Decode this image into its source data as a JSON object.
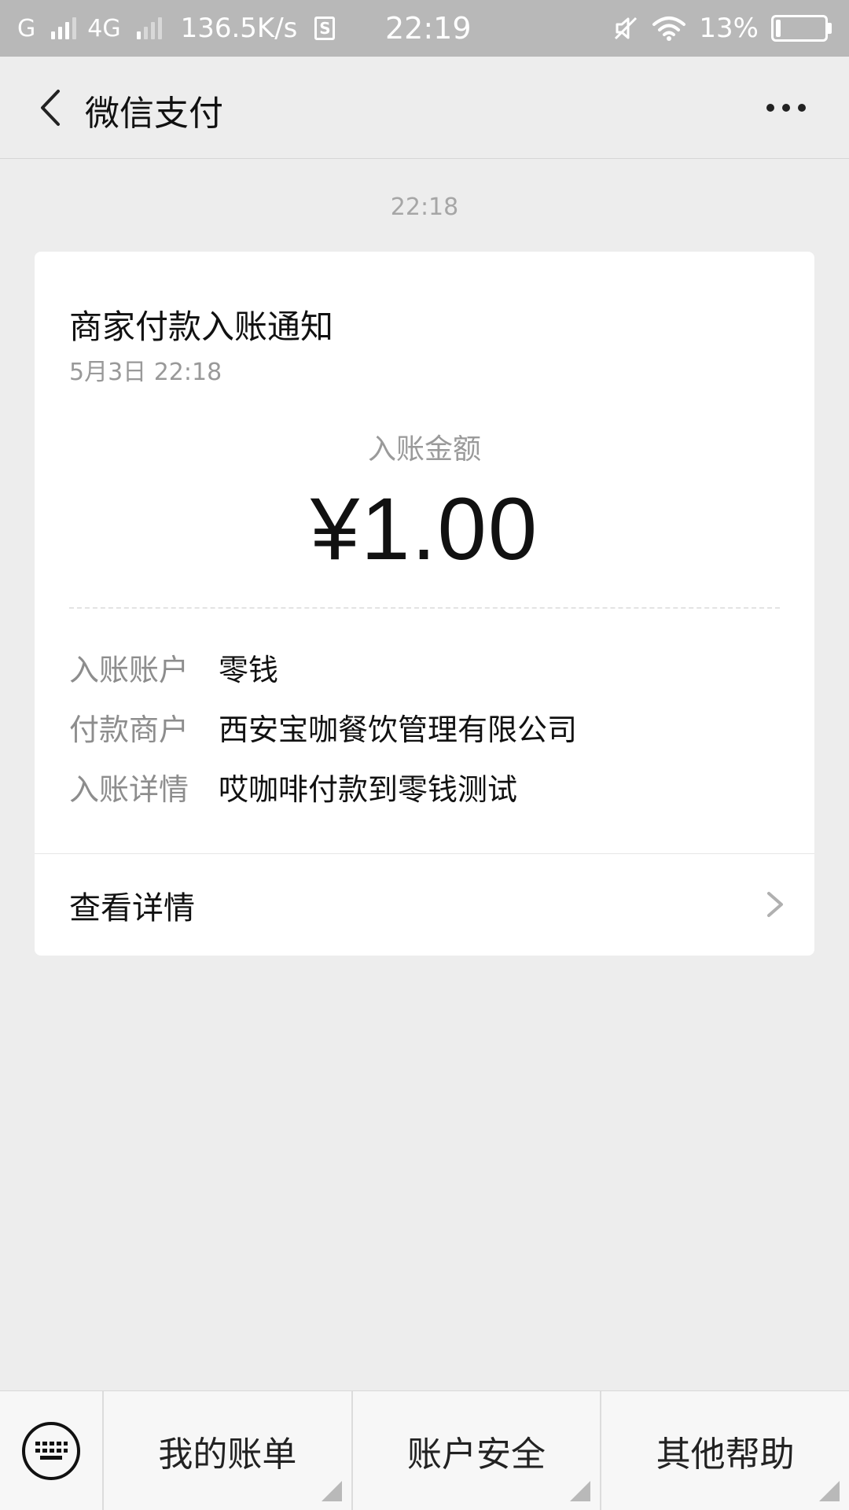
{
  "status_bar": {
    "carrier1": "G",
    "carrier2": "4G",
    "speed": "136.5K/s",
    "s_icon": "S",
    "time": "22:19",
    "battery": "13%",
    "icons": [
      "signal-icon",
      "wifi-icon",
      "mute-icon",
      "battery-icon"
    ]
  },
  "nav": {
    "title": "微信支付"
  },
  "message": {
    "time": "22:18"
  },
  "card": {
    "title": "商家付款入账通知",
    "date": "5月3日  22:18",
    "amount_label": "入账金额",
    "amount": "¥1.00",
    "rows": [
      {
        "label": "入账账户",
        "value": "零钱"
      },
      {
        "label": "付款商户",
        "value": "西安宝咖餐饮管理有限公司"
      },
      {
        "label": "入账详情",
        "value": "哎咖啡付款到零钱测试"
      }
    ],
    "detail_link": "查看详情"
  },
  "menu": {
    "items": [
      "我的账单",
      "账户安全",
      "其他帮助"
    ]
  },
  "colors": {
    "background": "#ededed",
    "status_bar": "#b8b8b8",
    "card": "#ffffff"
  }
}
